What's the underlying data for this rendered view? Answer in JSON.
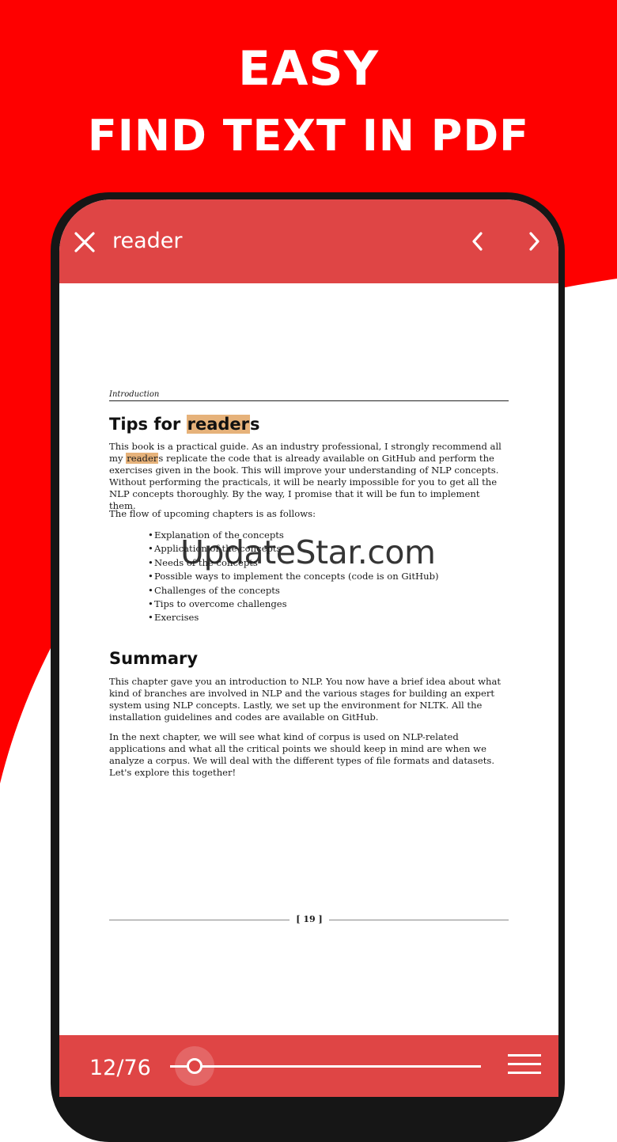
{
  "promo": {
    "line1": "EASY",
    "line2": "FIND TEXT IN PDF",
    "brand_color": "#fe0000"
  },
  "search_bar": {
    "close_icon": "close-icon",
    "query": "reader",
    "prev_icon": "chevron-left-icon",
    "next_icon": "chevron-right-icon",
    "bar_color": "#df4545"
  },
  "page": {
    "running_head": "Introduction",
    "section1": {
      "title_before": "Tips for ",
      "title_match": "reader",
      "title_after": "s",
      "para1_match": "reader",
      "para1_start": "This book is a practical guide. As an industry professional, I strongly recommend all my ",
      "para1_rest": "s replicate the code that is already available on GitHub and perform the exercises given in the book. This will improve your understanding of NLP concepts. Without performing the practicals, it will be nearly impossible for you to get all the NLP concepts thoroughly. By the way, I promise that it will be fun to implement them.",
      "para2": "The flow of upcoming chapters is as follows:",
      "bullets": [
        "Explanation of the concepts",
        "Application of the concepts",
        "Needs of the concepts",
        "Possible ways to implement the concepts (code is on GitHub)",
        "Challenges of the concepts",
        "Tips to overcome challenges",
        "Exercises"
      ]
    },
    "section2": {
      "title": "Summary",
      "para1": "This chapter gave you an introduction to NLP. You now have a brief idea about what kind of branches are involved in NLP and the various stages for building an expert system using NLP concepts. Lastly, we set up the environment for NLTK. All the installation guidelines and codes are available on GitHub.",
      "para2": "In the next chapter, we will see what kind of corpus is used on NLP-related applications and what all the critical points we should keep in mind are when we analyze a corpus. We will deal with the different types of file formats and datasets. Let's explore this together!"
    },
    "page_number": "[ 19 ]",
    "highlight_color": "#e6b27a"
  },
  "bottom_bar": {
    "page_counter": "12/76",
    "slider_progress": 0.08,
    "menu_icon": "hamburger-menu-icon"
  },
  "watermark": "UpdateStar.com"
}
